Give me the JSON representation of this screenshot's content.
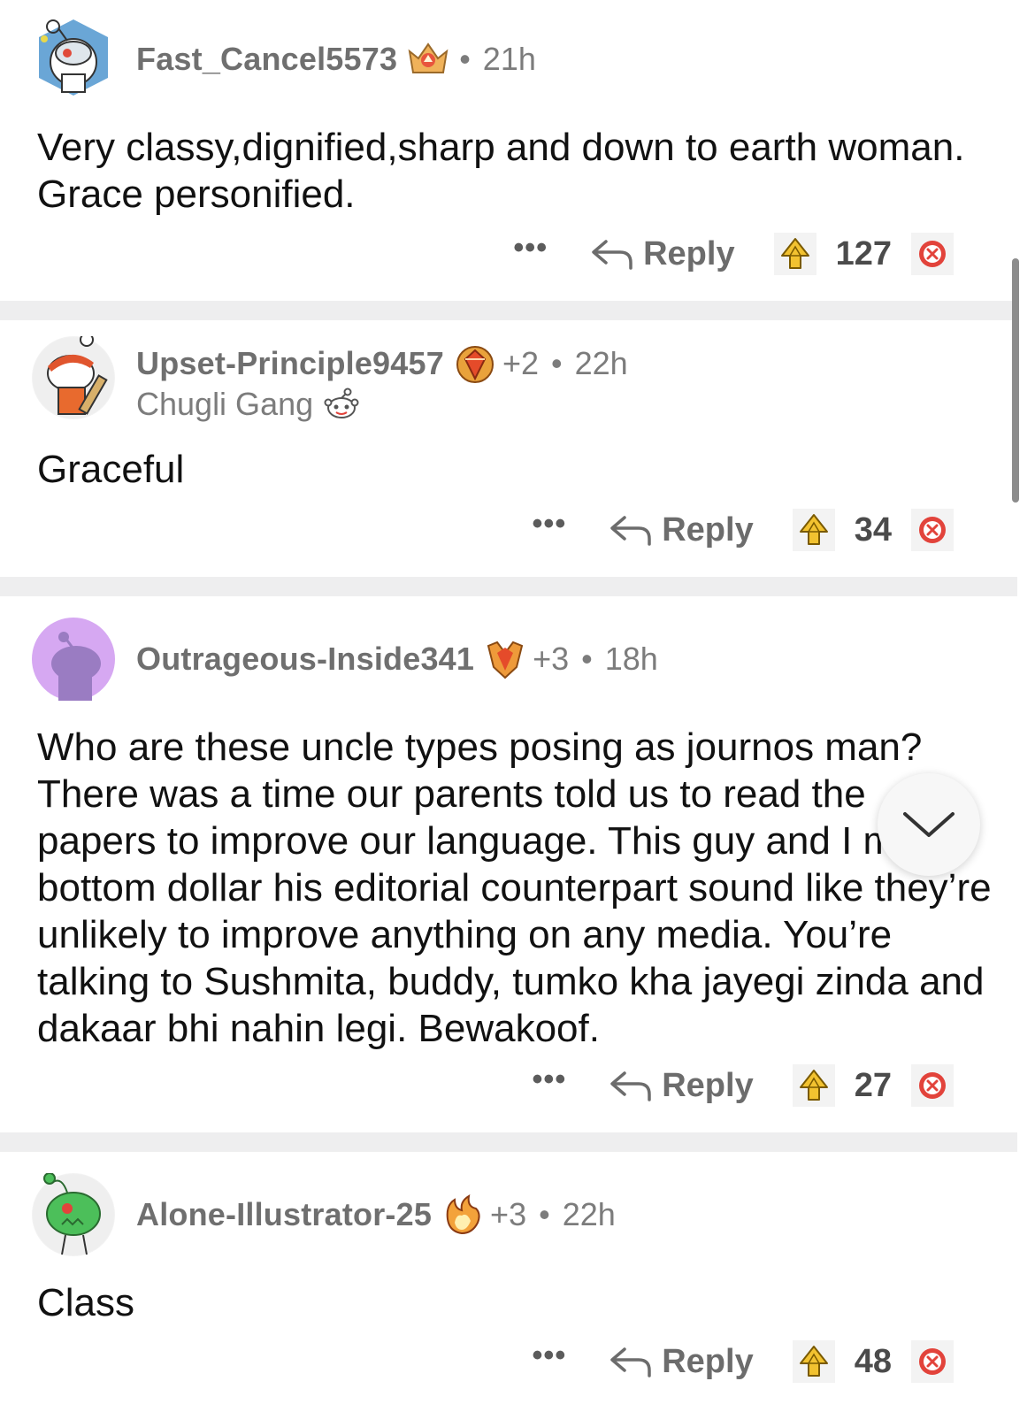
{
  "comments": [
    {
      "username": "Fast_Cancel5573",
      "award_count": "",
      "dot": "•",
      "time": "21h",
      "flair": "",
      "body": "Very classy,dignified,sharp and down to earth woman. Grace personified.",
      "more_label": "•••",
      "reply_label": "Reply",
      "score": "127",
      "avatar_icon": "robot-snoo-avatar-icon",
      "award_icon": "crown-award-icon"
    },
    {
      "username": "Upset-Principle9457",
      "award_count": "+2",
      "dot": "•",
      "time": "22h",
      "flair": "Chugli Gang",
      "body": "Graceful",
      "more_label": "•••",
      "reply_label": "Reply",
      "score": "34",
      "avatar_icon": "cricket-snoo-avatar-icon",
      "award_icon": "gem-award-icon"
    },
    {
      "username": "Outrageous-Inside341",
      "award_count": "+3",
      "dot": "•",
      "time": "18h",
      "flair": "",
      "body": "Who are these uncle types posing as journos man? There was a time our parents told us to read the papers to improve our language. This guy and I my bottom dollar his editorial counterpart sound like they’re unlikely to improve anything on any media. You’re talking to Sushmita, buddy, tumko kha jayegi zinda and dakaar bhi nahin legi. Bewakoof.",
      "more_label": "•••",
      "reply_label": "Reply",
      "score": "27",
      "avatar_icon": "default-snoo-avatar-icon",
      "award_icon": "crystal-award-icon"
    },
    {
      "username": "Alone-Illustrator-25",
      "award_count": "+3",
      "dot": "•",
      "time": "22h",
      "flair": "",
      "body": "Class",
      "more_label": "•••",
      "reply_label": "Reply",
      "score": "48",
      "avatar_icon": "green-alien-snoo-avatar-icon",
      "award_icon": "fire-award-icon"
    }
  ],
  "colors": {
    "divider": "#eeeeef",
    "meta_text": "#7c7c7c",
    "body_text": "#111111",
    "downvote": "#e2433b",
    "upvote_gold": "#f2c230"
  }
}
